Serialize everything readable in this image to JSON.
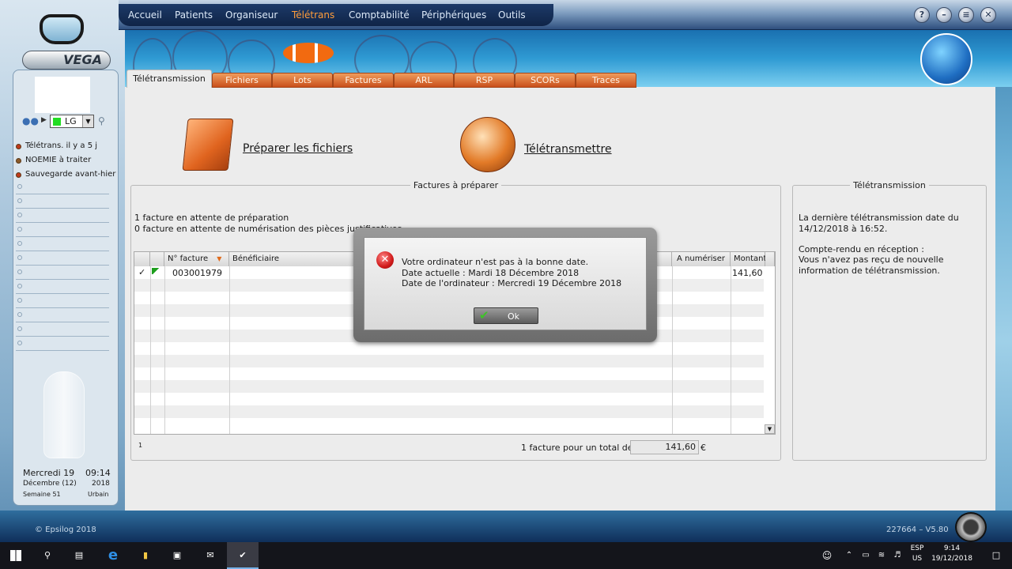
{
  "menu": {
    "items": [
      "Accueil",
      "Patients",
      "Organiseur",
      "Télétrans",
      "Comptabilité",
      "Périphériques",
      "Outils"
    ],
    "active": "Télétrans"
  },
  "window_buttons": {
    "help": "?",
    "minimize": "–",
    "restore": "≡",
    "close": "✕"
  },
  "brand": {
    "logo": "VEGA",
    "copyright": "© Epsilog 2018",
    "version": "227664 – V5.80"
  },
  "sidebar": {
    "user_code": "LG",
    "items": [
      {
        "label": "Télétrans. il y a 5 j",
        "icon": "red-dot-icon"
      },
      {
        "label": "NOEMIE à traiter",
        "icon": "brown-dot-icon"
      },
      {
        "label": "Sauvegarde avant-hier",
        "icon": "red-dot-icon"
      }
    ],
    "date": {
      "day": "Mercredi 19",
      "time": "09:14",
      "month": "Décembre (12)",
      "year": "2018",
      "week": "Semaine 51",
      "mode": "Urbain"
    }
  },
  "tabs": [
    "Télétransmission",
    "Fichiers",
    "Lots",
    "Factures",
    "ARL",
    "RSP",
    "SCORs",
    "Traces"
  ],
  "actions": {
    "prepare": "Préparer les fichiers",
    "transmit": "Télétransmettre"
  },
  "factures": {
    "legend": "Factures à préparer",
    "status1": "1 facture en attente de préparation",
    "status2": "0 facture en attente de numérisation des pièces justificatives",
    "columns": {
      "num": "N° facture",
      "beneficiaire": "Bénéficiaire",
      "a_numeriser": "A numériser",
      "montant": "Montant"
    },
    "rows": [
      {
        "check": "✓",
        "num": "003001979",
        "montant": "141,60"
      }
    ],
    "page": "1",
    "total_label": "1 facture pour un total de",
    "total_value": "141,60",
    "currency": "€"
  },
  "teletrans": {
    "legend": "Télétransmission",
    "line1": "La dernière télétransmission date du",
    "line2": "14/12/2018 à 16:52.",
    "line3": "Compte-rendu en réception :",
    "line4": "Vous n'avez pas reçu de nouvelle",
    "line5": "information de télétransmission."
  },
  "dialog": {
    "line1": "Votre ordinateur n'est pas à la bonne date.",
    "line2": "Date actuelle : Mardi 18 Décembre 2018",
    "line3": "Date de l'ordinateur : Mercredi 19 Décembre 2018",
    "ok": "Ok"
  },
  "taskbar": {
    "lang": "ESP",
    "layout": "US",
    "time": "9:14",
    "date": "19/12/2018"
  }
}
